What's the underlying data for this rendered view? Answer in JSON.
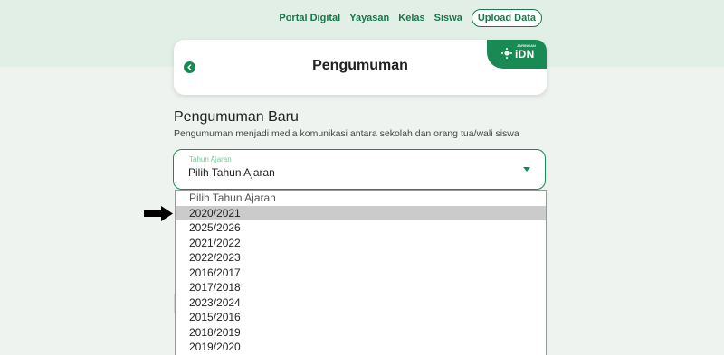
{
  "nav": {
    "items": [
      "Portal Digital",
      "Yayasan",
      "Kelas",
      "Siswa"
    ],
    "upload_label": "Upload Data"
  },
  "header": {
    "title": "Pengumuman",
    "logo_small": "JARINGAN",
    "logo_main": "iDN"
  },
  "section": {
    "title": "Pengumuman Baru",
    "description": "Pengumuman menjadi media komunikasi antara sekolah dan orang tua/wali siswa"
  },
  "select": {
    "label": "Tahun Ajaran",
    "value": "Pilih Tahun Ajaran",
    "options": [
      "Pilih Tahun Ajaran",
      "2020/2021",
      "2025/2026",
      "2021/2022",
      "2022/2023",
      "2016/2017",
      "2017/2018",
      "2023/2024",
      "2015/2016",
      "2018/2019",
      "2019/2020"
    ],
    "highlighted_index": 1
  },
  "colors": {
    "accent": "#1a8a55",
    "top_band": "#e2efe6",
    "background": "#eff3ef",
    "highlight": "#cbcbcb"
  },
  "icons": {
    "back": "chevron-left-icon",
    "caret": "caret-down-icon",
    "pointer": "arrow-right-icon"
  }
}
